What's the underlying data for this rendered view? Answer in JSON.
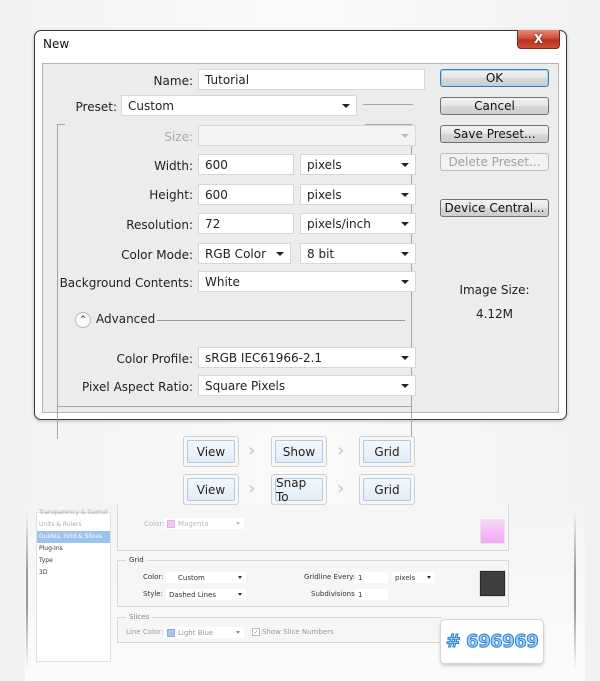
{
  "dialog": {
    "title": "New",
    "close_label": "X",
    "name_label": "Name:",
    "name_value": "Tutorial",
    "preset_label": "Preset:",
    "preset_value": "Custom",
    "size_label": "Size:",
    "size_value": "",
    "width_label": "Width:",
    "width_value": "600",
    "width_unit": "pixels",
    "height_label": "Height:",
    "height_value": "600",
    "height_unit": "pixels",
    "resolution_label": "Resolution:",
    "resolution_value": "72",
    "resolution_unit": "pixels/inch",
    "color_mode_label": "Color Mode:",
    "color_mode_value": "RGB Color",
    "bit_depth_value": "8 bit",
    "background_label": "Background Contents:",
    "background_value": "White",
    "advanced_label": "Advanced",
    "advanced_icon": "double-chevron-up",
    "color_profile_label": "Color Profile:",
    "color_profile_value": "sRGB IEC61966-2.1",
    "pixel_aspect_label": "Pixel Aspect Ratio:",
    "pixel_aspect_value": "Square Pixels",
    "buttons": {
      "ok": "OK",
      "cancel": "Cancel",
      "save_preset": "Save Preset...",
      "delete_preset": "Delete Preset...",
      "device_central": "Device Central..."
    },
    "image_size_label": "Image Size:",
    "image_size_value": "4.12M"
  },
  "breadcrumbs": [
    {
      "items": [
        "View",
        "Show",
        "Grid"
      ]
    },
    {
      "items": [
        "View",
        "Snap To",
        "Grid"
      ]
    }
  ],
  "breadcrumb_separator_icon": "chevron-right",
  "preferences": {
    "list_items": [
      {
        "label": "Transparency & Gamut",
        "state": "faded"
      },
      {
        "label": "Units & Rulers",
        "state": "faded"
      },
      {
        "label": "Guides, Grid & Slices",
        "state": "selected"
      },
      {
        "label": "Plug-Ins",
        "state": "normal"
      },
      {
        "label": "Type",
        "state": "normal"
      },
      {
        "label": "3D",
        "state": "normal"
      }
    ],
    "guides": {
      "color_label": "Color:",
      "color_value": "Magenta",
      "swatch_color": "#f5a6f5"
    },
    "grid": {
      "section_label": "Grid",
      "color_label": "Color:",
      "color_value": "Custom",
      "style_label": "Style:",
      "style_value": "Dashed Lines",
      "gridline_label": "Gridline Every:",
      "gridline_value": "1",
      "gridline_unit": "pixels",
      "subdivisions_label": "Subdivisions:",
      "subdivisions_value": "1",
      "swatch_color": "#3f3f3f"
    },
    "slices": {
      "section_label": "Slices",
      "line_color_label": "Line Color:",
      "line_color_value": "Light Blue",
      "swatch_color": "#a8c4f0",
      "show_numbers_label": "Show Slice Numbers",
      "show_numbers_checked": true
    }
  },
  "hex_badge": "# 696969"
}
